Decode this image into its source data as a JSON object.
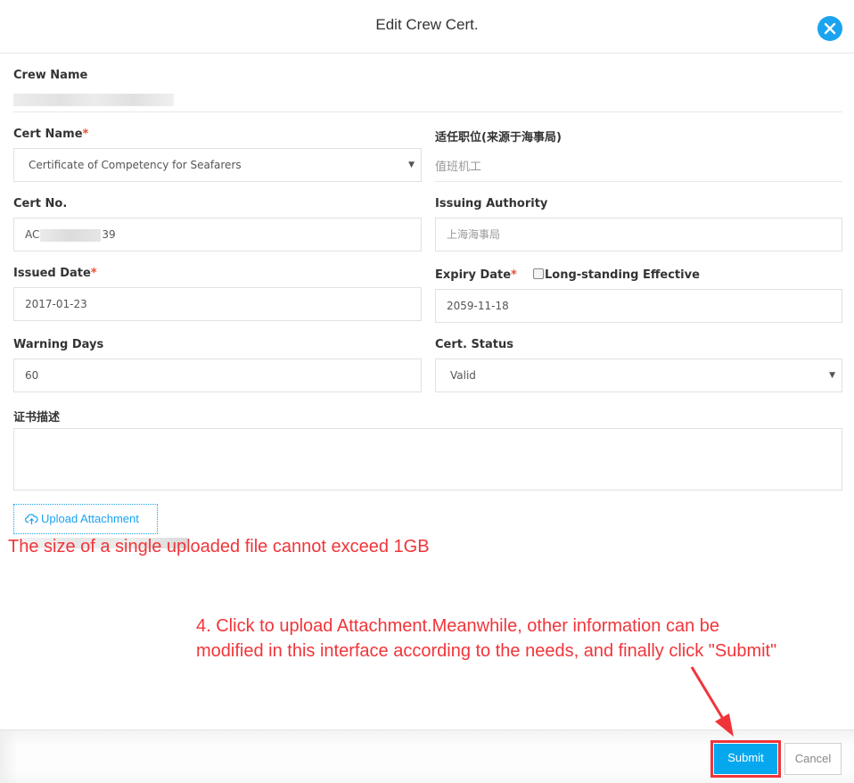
{
  "dialog": {
    "title": "Edit Crew Cert.",
    "close_icon": "close-circle-icon"
  },
  "form": {
    "crew_name": {
      "label": "Crew Name",
      "value": ""
    },
    "cert_name": {
      "label": "Cert Name",
      "required_mark": "*",
      "value": "Certificate of Competency for Seafarers",
      "caret": "▼"
    },
    "position": {
      "label": "适任职位(来源于海事局)",
      "value": "值班机工"
    },
    "cert_no": {
      "label": "Cert No.",
      "value_prefix": "AC",
      "value_suffix": "39"
    },
    "issuing_authority": {
      "label": "Issuing Authority",
      "value": "上海海事局"
    },
    "issued_date": {
      "label": "Issued Date",
      "required_mark": "*",
      "value": "2017-01-23"
    },
    "expiry_date": {
      "label": "Expiry Date",
      "required_mark": "*",
      "value": "2059-11-18"
    },
    "long_standing": {
      "label": "Long-standing Effective",
      "checked": false
    },
    "warning_days": {
      "label": "Warning Days",
      "value": "60"
    },
    "cert_status": {
      "label": "Cert. Status",
      "value": "Valid",
      "caret": "▼"
    },
    "description": {
      "label": "证书描述",
      "value": ""
    },
    "upload": {
      "label": "Upload Attachment",
      "icon": "cloud-upload-icon"
    }
  },
  "annotations": {
    "size_limit": "The size of a single uploaded file cannot exceed 1GB",
    "step_line1": "4. Click to upload Attachment.Meanwhile, other information can be",
    "step_line2": "modified in this interface according to the needs, and finally click \"Submit\"",
    "color": "#f0353a"
  },
  "footer": {
    "submit_label": "Submit",
    "cancel_label": "Cancel"
  },
  "colors": {
    "accent": "#1aa3f0",
    "submit_bg": "#05a8ef",
    "required": "#e8502f"
  }
}
